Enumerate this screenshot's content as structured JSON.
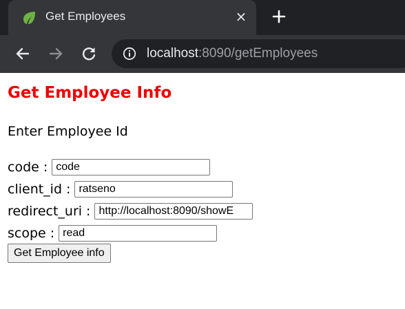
{
  "browser": {
    "tab_title": "Get Employees",
    "tab_close": "×",
    "url_host": "localhost",
    "url_rest": ":8090/getEmployees"
  },
  "page": {
    "title": "Get Employee Info",
    "subtitle": "Enter Employee Id",
    "separator": ":",
    "fields": [
      {
        "label": "code",
        "value": "code"
      },
      {
        "label": "client_id",
        "value": "ratseno"
      },
      {
        "label": "redirect_uri",
        "value": "http://localhost:8090/showE"
      },
      {
        "label": "scope",
        "value": "read"
      }
    ],
    "submit_label": "Get Employee info"
  },
  "colors": {
    "title": "#ee0000",
    "tabstrip": "#202124",
    "toolbar": "#35363a",
    "favicon": "#6db33f"
  },
  "icons": [
    "spring-leaf-icon",
    "close-icon",
    "plus-icon",
    "back-arrow-icon",
    "forward-arrow-icon",
    "reload-icon",
    "info-icon"
  ]
}
